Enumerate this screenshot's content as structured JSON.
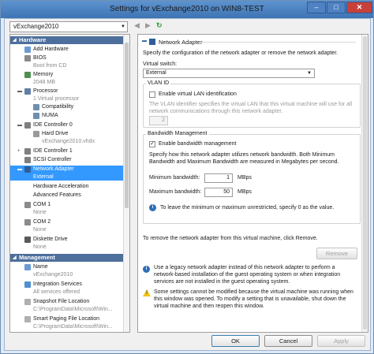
{
  "window": {
    "title": "Settings for vExchange2010 on WIN8-TEST",
    "minimize_glyph": "–",
    "maximize_glyph": "□",
    "close_glyph": "✕"
  },
  "vm_selector": {
    "value": "vExchange2010"
  },
  "toolbar": {
    "back_icon": "◀",
    "forward_icon": "▶",
    "refresh_icon": "↻"
  },
  "tree": {
    "hardware_header": "Hardware",
    "management_header": "Management",
    "items": [
      {
        "label": "Add Hardware",
        "icon": "add-hardware-icon"
      },
      {
        "label": "BIOS",
        "sub": "Boot from CD",
        "icon": "bios-icon"
      },
      {
        "label": "Memory",
        "sub": "2048 MB",
        "icon": "memory-icon"
      },
      {
        "label": "Processor",
        "sub": "1 Virtual processor",
        "icon": "processor-icon"
      },
      {
        "label": "Compatibility",
        "icon": "compatibility-icon"
      },
      {
        "label": "NUMA",
        "icon": "numa-icon"
      },
      {
        "label": "IDE Controller 0",
        "icon": "ide-controller-icon"
      },
      {
        "label": "Hard Drive",
        "sub": "vExchange2010.vhdx",
        "icon": "hard-drive-icon"
      },
      {
        "label": "IDE Controller 1",
        "icon": "ide-controller-icon"
      },
      {
        "label": "SCSI Controller",
        "icon": "scsi-controller-icon"
      },
      {
        "label": "Network Adapter",
        "sub": "External",
        "icon": "network-adapter-icon"
      },
      {
        "label": "Hardware Acceleration"
      },
      {
        "label": "Advanced Features"
      },
      {
        "label": "COM 1",
        "sub": "None",
        "icon": "com-port-icon"
      },
      {
        "label": "COM 2",
        "sub": "None",
        "icon": "com-port-icon"
      },
      {
        "label": "Diskette Drive",
        "sub": "None",
        "icon": "diskette-drive-icon"
      }
    ],
    "management_items": [
      {
        "label": "Name",
        "sub": "vExchange2010",
        "icon": "name-icon"
      },
      {
        "label": "Integration Services",
        "sub": "All services offered",
        "icon": "integration-services-icon"
      },
      {
        "label": "Snapshot File Location",
        "sub": "C:\\ProgramData\\Microsoft\\Win...",
        "icon": "snapshot-icon"
      },
      {
        "label": "Smart Paging File Location",
        "sub": "C:\\ProgramData\\Microsoft\\Win...",
        "icon": "smart-paging-icon"
      }
    ]
  },
  "panel": {
    "header": "Network Adapter",
    "intro": "Specify the configuration of the network adapter or remove the network adapter.",
    "virtual_switch_label": "Virtual switch:",
    "virtual_switch_value": "External",
    "vlan_group": "VLAN ID",
    "vlan_checkbox": "Enable virtual LAN identification",
    "vlan_checked": false,
    "vlan_desc": "The VLAN identifier specifies the virtual LAN that this virtual machine will use for all network communications through this network adapter.",
    "vlan_value": "2",
    "bw_group": "Bandwidth Management",
    "bw_checkbox": "Enable bandwidth management",
    "bw_checked": true,
    "bw_desc": "Specify how this network adapter utilizes network bandwidth. Both Minimum Bandwidth and Maximum Bandwidth are measured in Megabytes per second.",
    "min_label": "Minimum bandwidth:",
    "min_value": "1",
    "min_unit": "MBps",
    "max_label": "Maximum bandwidth:",
    "max_value": "50",
    "max_unit": "MBps",
    "bw_info": "To leave the minimum or maximum unrestricted, specify 0 as the value.",
    "remove_text": "To remove the network adapter from this virtual machine, click Remove.",
    "remove_button": "Remove",
    "legacy_info": "Use a legacy network adapter instead of this network adapter to perform a network-based installation of the guest operating system or when integration services are not installed in the guest operating system.",
    "warning": "Some settings cannot be modified because the virtual machine was running when this window was opened. To modify a setting that is unavailable, shut down the virtual machine and then reopen this window."
  },
  "buttons": {
    "ok": "OK",
    "cancel": "Cancel",
    "apply": "Apply"
  },
  "colors": {
    "selection": "#3399ff",
    "section_header": "#4d6f9c",
    "titlebar": "#4f86c6"
  }
}
